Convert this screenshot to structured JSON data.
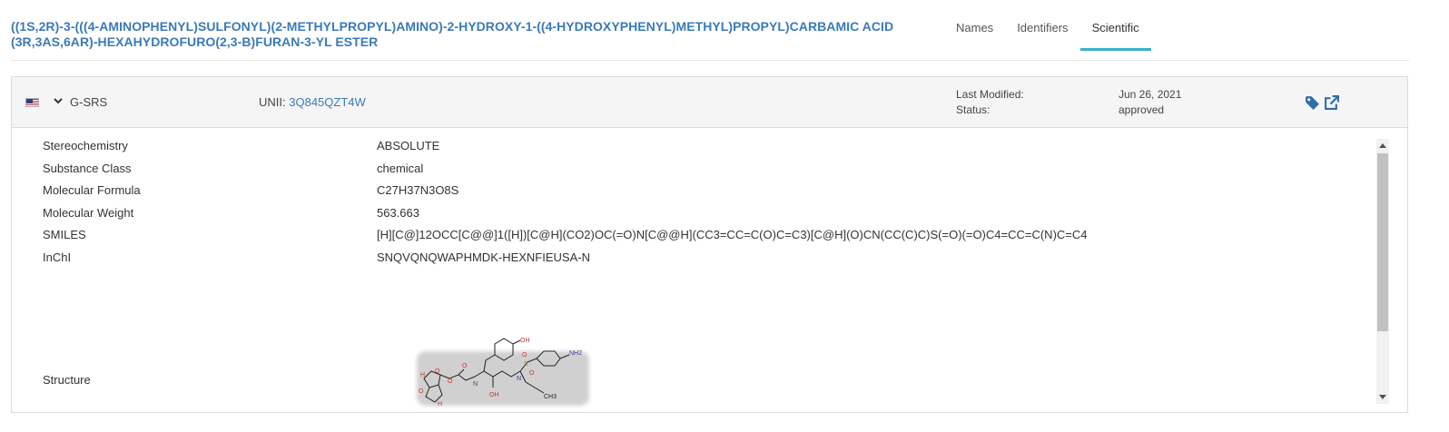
{
  "title": "((1S,2R)-3-(((4-AMINOPHENYL)SULFONYL)(2-METHYLPROPYL)AMINO)-2-HYDROXY-1-((4-HYDROXYPHENYL)METHYL)PROPYL)CARBAMIC ACID (3R,3AS,6AR)-HEXAHYDROFURO(2,3-B)FURAN-3-YL ESTER",
  "tabs": [
    {
      "label": "Names",
      "active": false
    },
    {
      "label": "Identifiers",
      "active": false
    },
    {
      "label": "Scientific",
      "active": true
    }
  ],
  "card": {
    "source": "G-SRS",
    "flag_icon": "us-flag-icon",
    "unii_label": "UNII:",
    "unii_value": "3Q845QZT4W",
    "last_modified_label": "Last Modified:",
    "last_modified_value": "Jun 26, 2021",
    "status_label": "Status:",
    "status_value": "approved",
    "header_icons": [
      "tag-icon",
      "external-link-icon"
    ]
  },
  "properties": [
    {
      "label": "Stereochemistry",
      "value": "ABSOLUTE"
    },
    {
      "label": "Substance Class",
      "value": "chemical"
    },
    {
      "label": "Molecular Formula",
      "value": "C27H37N3O8S"
    },
    {
      "label": "Molecular Weight",
      "value": "563.663"
    },
    {
      "label": "SMILES",
      "value": "[H][C@]12OCC[C@@]1([H])[C@H](CO2)OC(=O)N[C@@H](CC3=CC=C(O)C=C3)[C@H](O)CN(CC(C)C)S(=O)(=O)C4=CC=C(N)C=C4"
    },
    {
      "label": "InChI",
      "value": "SNQVQNQWAPHMDK-HEXNFIEUSA-N"
    }
  ],
  "structure": {
    "label": "Structure",
    "atom_labels": [
      "H",
      "H",
      "O",
      "O",
      "O",
      "O",
      "N",
      "OH",
      "OH",
      "N",
      "S",
      "O",
      "O",
      "NH2",
      "CH3"
    ]
  },
  "colors": {
    "accent": "#3a7ab8",
    "active_tab": "#38b2c9",
    "header_bg": "#f5f5f5"
  }
}
